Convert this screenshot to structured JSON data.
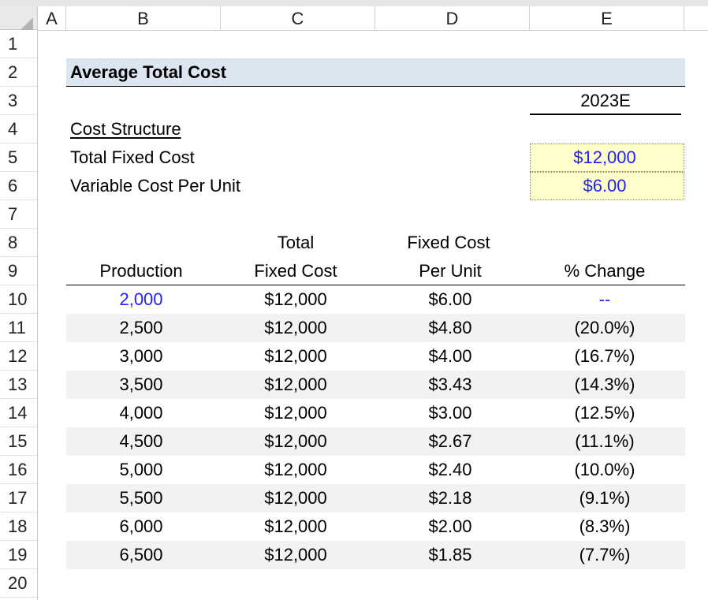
{
  "columns": [
    "A",
    "B",
    "C",
    "D",
    "E"
  ],
  "rows": [
    "1",
    "2",
    "3",
    "4",
    "5",
    "6",
    "7",
    "8",
    "9",
    "10",
    "11",
    "12",
    "13",
    "14",
    "15",
    "16",
    "17",
    "18",
    "19",
    "20"
  ],
  "title": "Average Total Cost",
  "year_header": "2023E",
  "cost_structure": {
    "label": "Cost Structure",
    "total_fixed_cost_label": "Total Fixed Cost",
    "total_fixed_cost_value": "$12,000",
    "variable_cost_label": "Variable Cost Per Unit",
    "variable_cost_value": "$6.00"
  },
  "table": {
    "headers": {
      "production": "Production",
      "tfc_line1": "Total",
      "tfc_line2": "Fixed Cost",
      "fcpu_line1": "Fixed Cost",
      "fcpu_line2": "Per Unit",
      "pct_change": "% Change"
    },
    "rows": [
      {
        "production": "2,000",
        "tfc": "$12,000",
        "fcpu": "$6.00",
        "pct": "--"
      },
      {
        "production": "2,500",
        "tfc": "$12,000",
        "fcpu": "$4.80",
        "pct": "(20.0%)"
      },
      {
        "production": "3,000",
        "tfc": "$12,000",
        "fcpu": "$4.00",
        "pct": "(16.7%)"
      },
      {
        "production": "3,500",
        "tfc": "$12,000",
        "fcpu": "$3.43",
        "pct": "(14.3%)"
      },
      {
        "production": "4,000",
        "tfc": "$12,000",
        "fcpu": "$3.00",
        "pct": "(12.5%)"
      },
      {
        "production": "4,500",
        "tfc": "$12,000",
        "fcpu": "$2.67",
        "pct": "(11.1%)"
      },
      {
        "production": "5,000",
        "tfc": "$12,000",
        "fcpu": "$2.40",
        "pct": "(10.0%)"
      },
      {
        "production": "5,500",
        "tfc": "$12,000",
        "fcpu": "$2.18",
        "pct": "(9.1%)"
      },
      {
        "production": "6,000",
        "tfc": "$12,000",
        "fcpu": "$2.00",
        "pct": "(8.3%)"
      },
      {
        "production": "6,500",
        "tfc": "$12,000",
        "fcpu": "$1.85",
        "pct": "(7.7%)"
      }
    ]
  },
  "colors": {
    "title_band": "#dce6f1",
    "input_fill": "#ffffcc",
    "input_text": "#1f1fff",
    "band_fill": "#f2f2f2"
  }
}
